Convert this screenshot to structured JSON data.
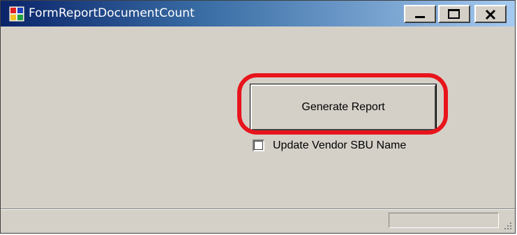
{
  "window": {
    "title": "FormReportDocumentCount",
    "minimize_icon": "minimize-icon",
    "maximize_icon": "maximize-icon",
    "close_icon": "close-icon"
  },
  "main": {
    "generate_button_label": "Generate Report",
    "update_vendor_checkbox": {
      "label": "Update Vendor SBU Name",
      "checked": false
    }
  },
  "statusbar": {
    "progress": 0
  },
  "colors": {
    "highlight": "#e8141c",
    "titlebar_start": "#0a246a",
    "titlebar_end": "#a6caf0",
    "window_bg": "#d4d0c8"
  }
}
